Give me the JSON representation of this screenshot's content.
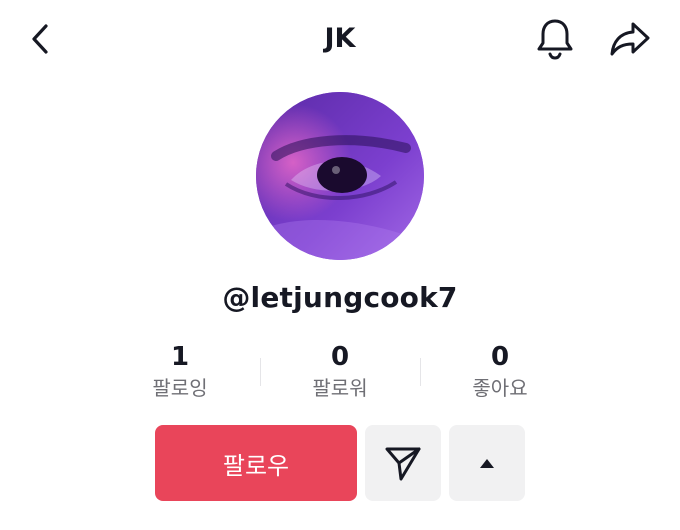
{
  "header": {
    "title": "JK",
    "icons": {
      "back": "chevron-left-icon",
      "notifications": "bell-icon",
      "share": "share-arrow-icon"
    }
  },
  "profile": {
    "avatar": "profile-avatar",
    "username": "@letjungcook7"
  },
  "stats": [
    {
      "value": "1",
      "label": "팔로잉"
    },
    {
      "value": "0",
      "label": "팔로워"
    },
    {
      "value": "0",
      "label": "좋아요"
    }
  ],
  "actions": {
    "follow_label": "팔로우",
    "message_icon": "send-icon",
    "more_icon": "caret-up-icon"
  },
  "colors": {
    "accent": "#e9455a",
    "secondary_button": "#f1f1f2",
    "text": "#161823",
    "muted_text": "#6f6f75"
  }
}
